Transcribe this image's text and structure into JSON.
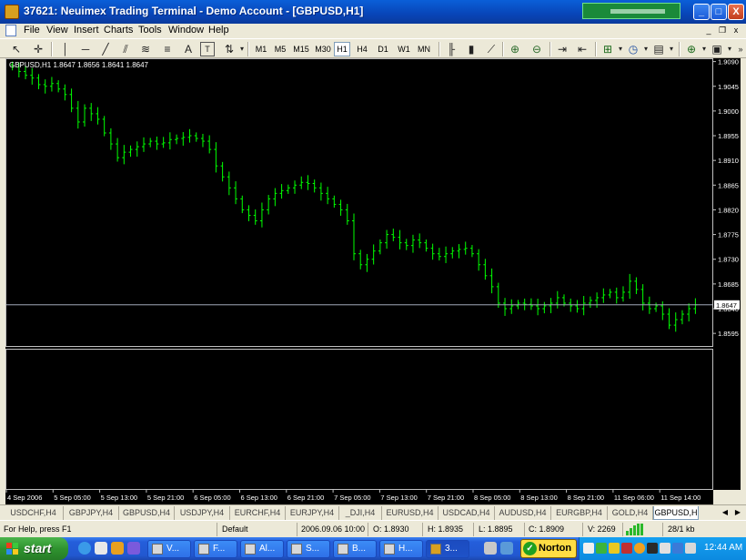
{
  "window": {
    "title": "37621: Neuimex Trading Terminal - Demo Account - [GBPUSD,H1]",
    "min_label": "_",
    "max_label": "□",
    "close_label": "X"
  },
  "menu": {
    "items": [
      "File",
      "View",
      "Insert",
      "Charts",
      "Tools",
      "Window",
      "Help"
    ],
    "mdi_min": "_",
    "mdi_restore": "❐",
    "mdi_close": "x"
  },
  "toolbar": {
    "timeframes": [
      "M1",
      "M5",
      "M15",
      "M30",
      "H1",
      "H4",
      "D1",
      "W1",
      "MN"
    ],
    "active_timeframe": "H1",
    "text_tool": "A",
    "text_label_tool": "T"
  },
  "chart": {
    "header": "GBPUSD,H1  1.8647 1.8656 1.8641 1.8647",
    "current_price_label": "1.8647",
    "bar_color": "#00ff00",
    "background": "#000000"
  },
  "chart_data": {
    "type": "ohlc",
    "symbol": "GBPUSD",
    "timeframe": "H1",
    "last": {
      "open": 1.8647,
      "high": 1.8656,
      "low": 1.8641,
      "close": 1.8647
    },
    "ylim": [
      1.8572,
      1.9096
    ],
    "y_ticks": [
      "1.9090",
      "1.9045",
      "1.9000",
      "1.8955",
      "1.8910",
      "1.8865",
      "1.8820",
      "1.8775",
      "1.8730",
      "1.8685",
      "1.8640",
      "1.8595"
    ],
    "x_ticks": [
      "4 Sep 2006",
      "5 Sep 05:00",
      "5 Sep 13:00",
      "5 Sep 21:00",
      "6 Sep 05:00",
      "6 Sep 13:00",
      "6 Sep 21:00",
      "7 Sep 05:00",
      "7 Sep 13:00",
      "7 Sep 21:00",
      "8 Sep 05:00",
      "8 Sep 13:00",
      "8 Sep 21:00",
      "11 Sep 06:00",
      "11 Sep 14:00"
    ],
    "closes": [
      1.908,
      1.9072,
      1.9065,
      1.906,
      1.9048,
      1.9045,
      1.905,
      1.904,
      1.903,
      1.9005,
      1.898,
      1.9005,
      1.8995,
      1.8985,
      1.896,
      1.894,
      1.8915,
      1.8925,
      1.893,
      1.8935,
      1.894,
      1.8945,
      1.894,
      1.8942,
      1.8948,
      1.895,
      1.8952,
      1.8955,
      1.895,
      1.8945,
      1.893,
      1.89,
      1.888,
      1.886,
      1.884,
      1.882,
      1.881,
      1.88,
      1.882,
      1.884,
      1.885,
      1.8855,
      1.886,
      1.8865,
      1.887,
      1.8868,
      1.886,
      1.885,
      1.884,
      1.883,
      1.882,
      1.88,
      1.874,
      1.872,
      1.873,
      1.8745,
      1.876,
      1.8775,
      1.877,
      1.876,
      1.8755,
      1.8765,
      1.876,
      1.875,
      1.874,
      1.8735,
      1.874,
      1.8745,
      1.8748,
      1.875,
      1.874,
      1.872,
      1.87,
      1.868,
      1.865,
      1.864,
      1.8645,
      1.865,
      1.8648,
      1.8645,
      1.864,
      1.8645,
      1.865,
      1.866,
      1.865,
      1.8645,
      1.864,
      1.865,
      1.8655,
      1.866,
      1.8665,
      1.867,
      1.866,
      1.867,
      1.869,
      1.8675,
      1.865,
      1.864,
      1.8645,
      1.863,
      1.861,
      1.862,
      1.863,
      1.864,
      1.8647
    ],
    "indicator_window": "empty sub-window below main chart"
  },
  "tabs": {
    "items": [
      "USDCHF,H4",
      "GBPJPY,H4",
      "GBPUSD,H4",
      "USDJPY,H4",
      "EURCHF,H4",
      "EURJPY,H4",
      "_DJI,H4",
      "EURUSD,H4",
      "USDCAD,H4",
      "AUDUSD,H4",
      "EURGBP,H4",
      "GOLD,H4",
      "GBPUSD,H"
    ],
    "active_index": 12,
    "left_arrow": "◀",
    "right_arrow": "▶"
  },
  "statusbar": {
    "help": "For Help, press F1",
    "profile": "Default",
    "datetime": "2006.09.06 10:00",
    "open": "O: 1.8930",
    "high": "H: 1.8935",
    "low": "L: 1.8895",
    "close": "C: 1.8909",
    "volume": "V: 2269",
    "traffic": "28/1 kb"
  },
  "taskbar": {
    "start_label": "start",
    "tasks": [
      "V...",
      "F...",
      "Al...",
      "S...",
      "B...",
      "H...",
      "3..."
    ],
    "active_task_index": 6,
    "norton_label": "Norton",
    "clock": "12:44 AM"
  }
}
